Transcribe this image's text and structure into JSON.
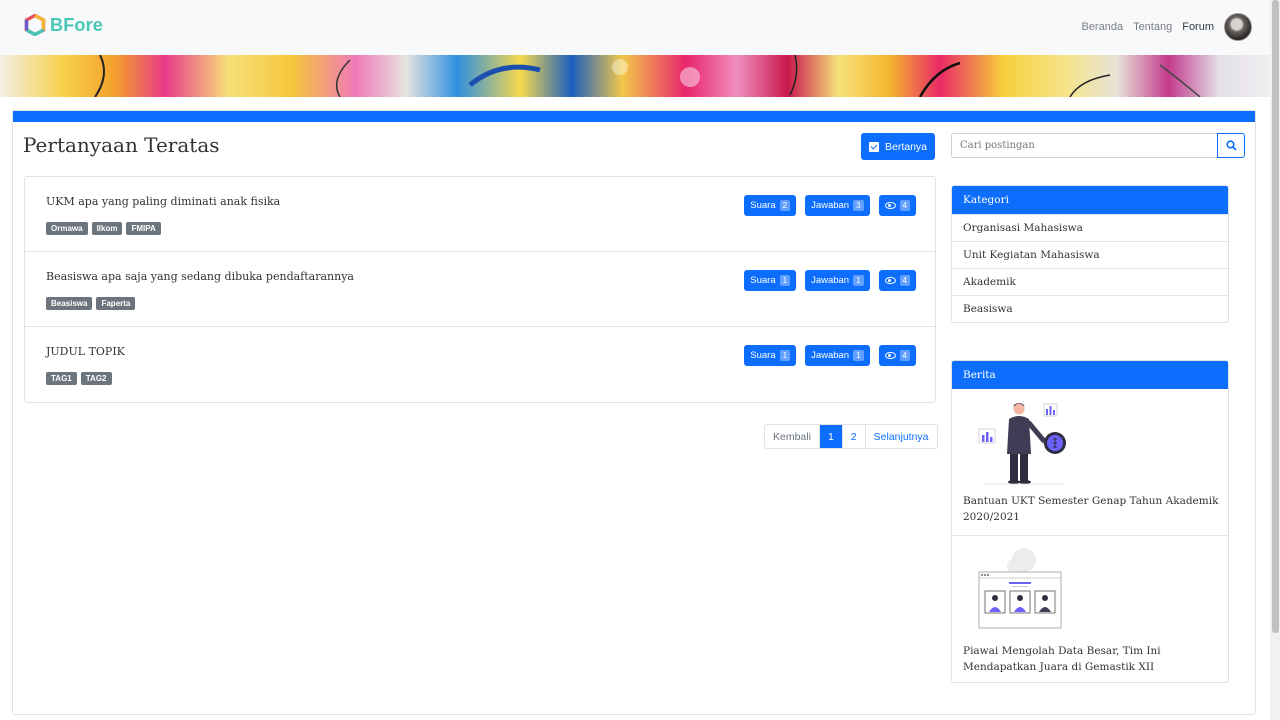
{
  "brand": {
    "name": "BFore"
  },
  "nav": {
    "links": [
      "Beranda",
      "Tentang",
      "Forum"
    ]
  },
  "main": {
    "title": "Pertanyaan Teratas",
    "ask_label": "Bertanya",
    "search_placeholder": "Cari postingan",
    "questions": [
      {
        "title": "UKM apa yang paling diminati anak fisika",
        "tags": [
          "Ormawa",
          "Ilkom",
          "FMIPA"
        ],
        "suara_label": "Suara",
        "suara": "2",
        "jawaban_label": "Jawaban",
        "jawaban": "3",
        "views": "4"
      },
      {
        "title": "Beasiswa apa saja yang sedang dibuka pendaftarannya",
        "tags": [
          "Beasiswa",
          "Faperta"
        ],
        "suara_label": "Suara",
        "suara": "1",
        "jawaban_label": "Jawaban",
        "jawaban": "1",
        "views": "4"
      },
      {
        "title": "JUDUL TOPIK",
        "tags": [
          "TAG1",
          "TAG2"
        ],
        "suara_label": "Suara",
        "suara": "1",
        "jawaban_label": "Jawaban",
        "jawaban": "1",
        "views": "4"
      }
    ],
    "pagination": {
      "prev": "Kembali",
      "pages": [
        "1",
        "2"
      ],
      "active": "1",
      "next": "Selanjutnya"
    }
  },
  "sidebar": {
    "kategori_title": "Kategori",
    "kategori": [
      "Organisasi Mahasiswa",
      "Unit Kegiatan Mahasiswa",
      "Akademik",
      "Beasiswa"
    ],
    "berita_title": "Berita",
    "berita": [
      {
        "title": "Bantuan UKT Semester Genap Tahun Akademik 2020/2021"
      },
      {
        "title": "Piawai Mengolah Data Besar, Tim Ini Mendapatkan Juara di Gemastik XII"
      }
    ]
  },
  "colors": {
    "primary": "#0d6efd",
    "brand": "#48c6b8",
    "tag": "#6c757d"
  }
}
